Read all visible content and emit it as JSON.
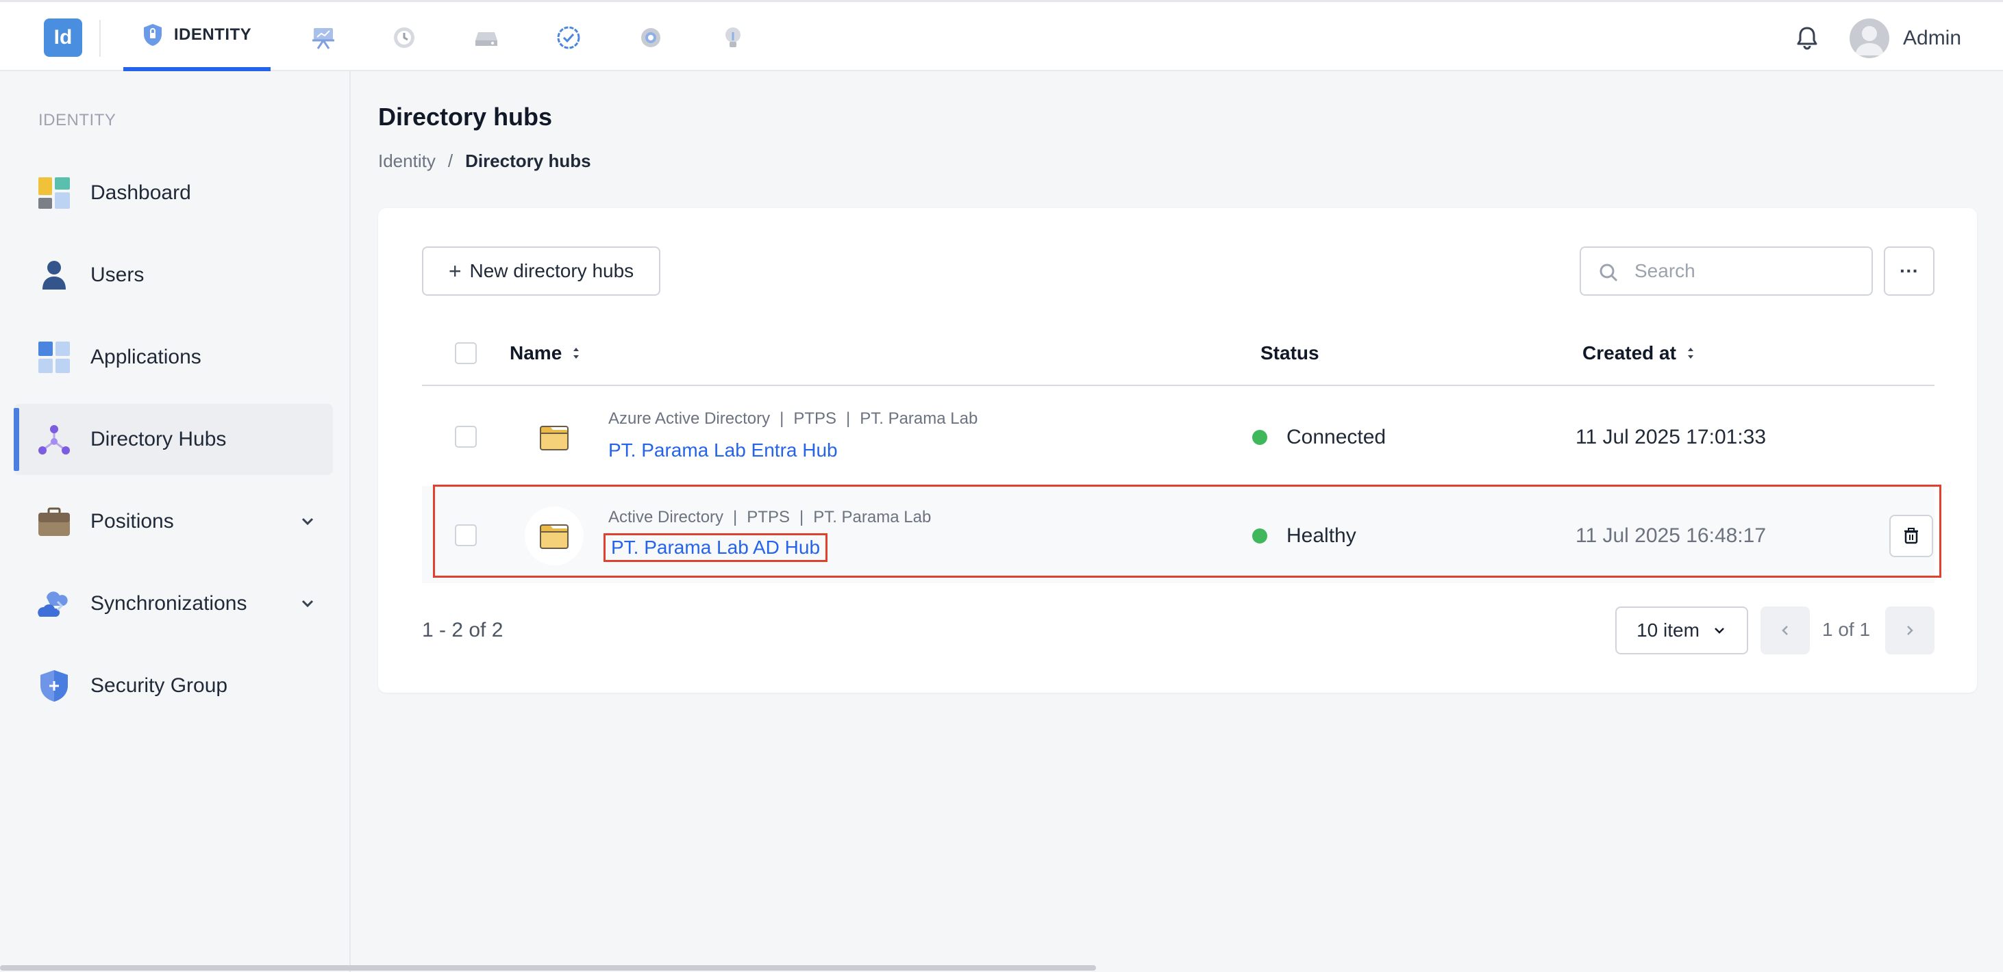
{
  "app": {
    "logo_text": "Id",
    "nav_active_label": "IDENTITY",
    "nav_icons": [
      "presentation-icon",
      "history-icon",
      "drive-icon",
      "check-badge-icon",
      "settings-icon",
      "lightbulb-icon"
    ],
    "user_name": "Admin",
    "accent_color": "#2563eb"
  },
  "sidebar": {
    "heading": "IDENTITY",
    "items": [
      {
        "label": "Dashboard",
        "icon": "dashboard-icon"
      },
      {
        "label": "Users",
        "icon": "user-icon"
      },
      {
        "label": "Applications",
        "icon": "applications-icon"
      },
      {
        "label": "Directory Hubs",
        "icon": "directory-hub-icon",
        "active": true
      },
      {
        "label": "Positions",
        "icon": "briefcase-icon",
        "expandable": true
      },
      {
        "label": "Synchronizations",
        "icon": "sync-cloud-icon",
        "expandable": true
      },
      {
        "label": "Security Group",
        "icon": "shield-icon"
      }
    ]
  },
  "page": {
    "title": "Directory hubs",
    "breadcrumb": {
      "root": "Identity",
      "separator": "/",
      "current": "Directory hubs"
    }
  },
  "toolbar": {
    "new_label": "New directory hubs",
    "search_placeholder": "Search",
    "more_label": "···"
  },
  "table": {
    "columns": {
      "name": "Name",
      "status": "Status",
      "created_at": "Created at"
    },
    "rows": [
      {
        "meta": [
          "Azure Active Directory",
          "PTPS",
          "PT. Parama Lab"
        ],
        "name": "PT. Parama Lab Entra Hub",
        "status": "Connected",
        "status_color": "#3fb75a",
        "created_at": "11 Jul 2025 17:01:33"
      },
      {
        "meta": [
          "Active Directory",
          "PTPS",
          "PT. Parama Lab"
        ],
        "name": "PT. Parama Lab AD Hub",
        "status": "Healthy",
        "status_color": "#3fb75a",
        "created_at": "11 Jul 2025 16:48:17",
        "highlighted": true
      }
    ]
  },
  "pagination": {
    "summary": "1 - 2 of 2",
    "page_size": "10 item",
    "page_label": "1 of 1"
  }
}
